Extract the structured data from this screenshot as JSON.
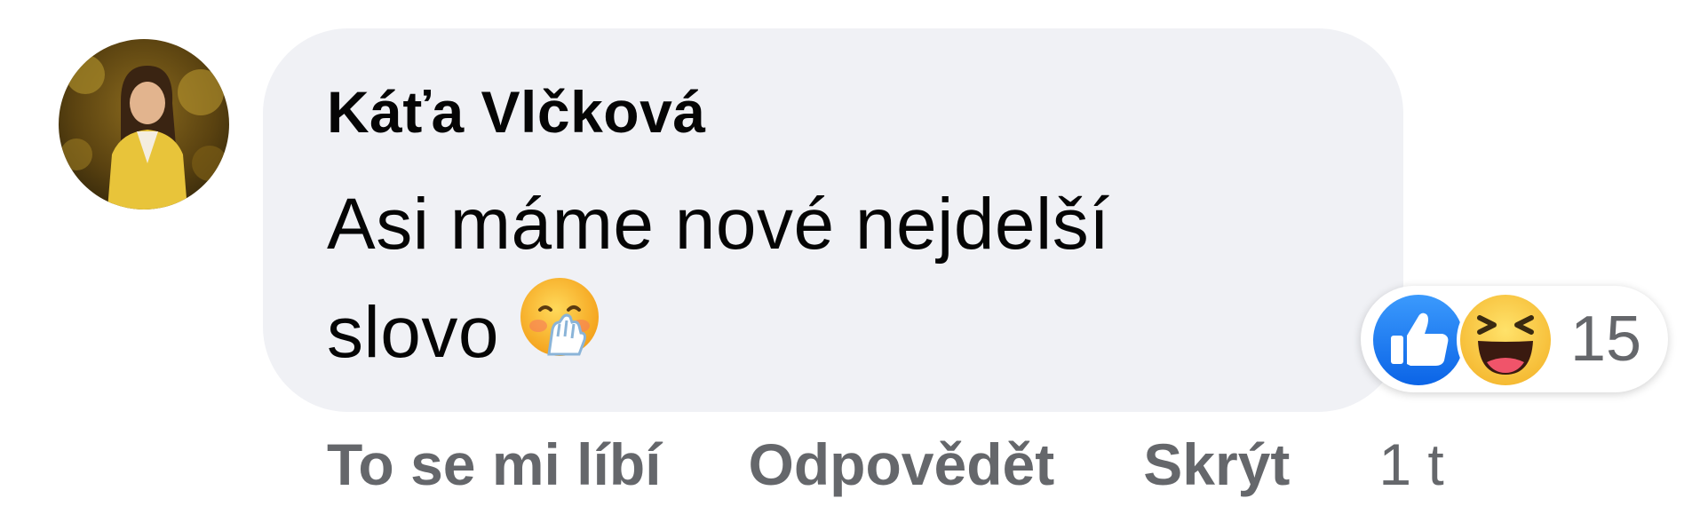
{
  "comment": {
    "author": "Káťa Vlčková",
    "text_lines": [
      "Asi máme nové nejdelší",
      "slovo"
    ],
    "inline_emoji": "face-with-hand-over-mouth",
    "reactions": {
      "icons": [
        "like-icon",
        "haha-icon"
      ],
      "count": "15"
    },
    "actions": {
      "like": "To se mi líbí",
      "reply": "Odpovědět",
      "hide": "Skrýt",
      "timestamp": "1 t"
    }
  },
  "colors": {
    "bubble": "#f0f1f5",
    "text": "#050505",
    "secondary": "#65676b",
    "like_blue": "#1877f2",
    "haha_yellow": "#fcc744"
  }
}
